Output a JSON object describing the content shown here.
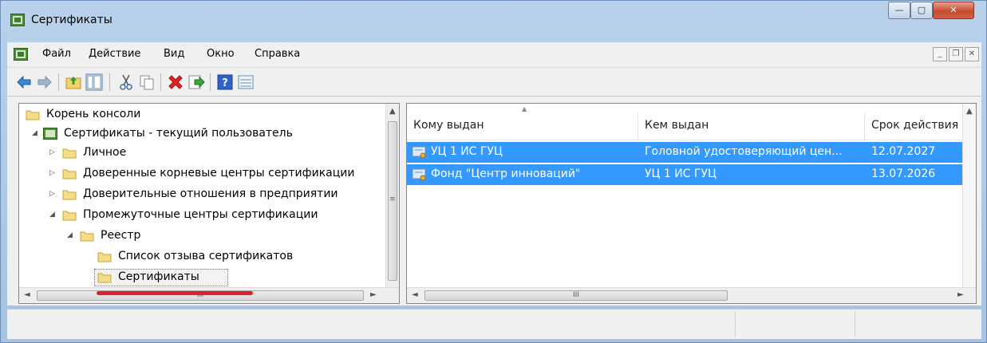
{
  "window": {
    "title": "Сертификаты"
  },
  "menu": {
    "items": [
      {
        "label": "Файл"
      },
      {
        "label": "Действие"
      },
      {
        "label": "Вид"
      },
      {
        "label": "Окно"
      },
      {
        "label": "Справка"
      }
    ]
  },
  "toolbar": {
    "icons": [
      "back-arrow-icon",
      "forward-arrow-icon",
      "up-folder-icon",
      "show-hide-tree-icon",
      "cut-icon",
      "copy-icon",
      "delete-icon",
      "export-icon",
      "help-icon",
      "properties-icon"
    ]
  },
  "tree": {
    "items": [
      {
        "label": "Корень консоли"
      },
      {
        "label": "Сертификаты - текущий пользователь"
      },
      {
        "label": "Личное"
      },
      {
        "label": "Доверенные корневые центры сертификации"
      },
      {
        "label": "Доверительные отношения в предприятии"
      },
      {
        "label": "Промежуточные центры сертификации"
      },
      {
        "label": "Реестр"
      },
      {
        "label": "Список отзыва сертификатов"
      },
      {
        "label": "Сертификаты"
      }
    ]
  },
  "list": {
    "columns": [
      {
        "label": "Кому выдан"
      },
      {
        "label": "Кем выдан"
      },
      {
        "label": "Срок действия"
      }
    ],
    "rows": [
      {
        "issued_to": "УЦ 1 ИС ГУЦ",
        "issued_by": "Головной удостоверяющий цен...",
        "expires": "12.07.2027"
      },
      {
        "issued_to": "Фонд \"Центр инноваций\"",
        "issued_by": "УЦ 1 ИС ГУЦ",
        "expires": "13.07.2026"
      }
    ]
  },
  "scroll": {
    "thumb_glyph": "III"
  },
  "colors": {
    "selection": "#3399ff",
    "annotation_underline": "#e0202a"
  }
}
